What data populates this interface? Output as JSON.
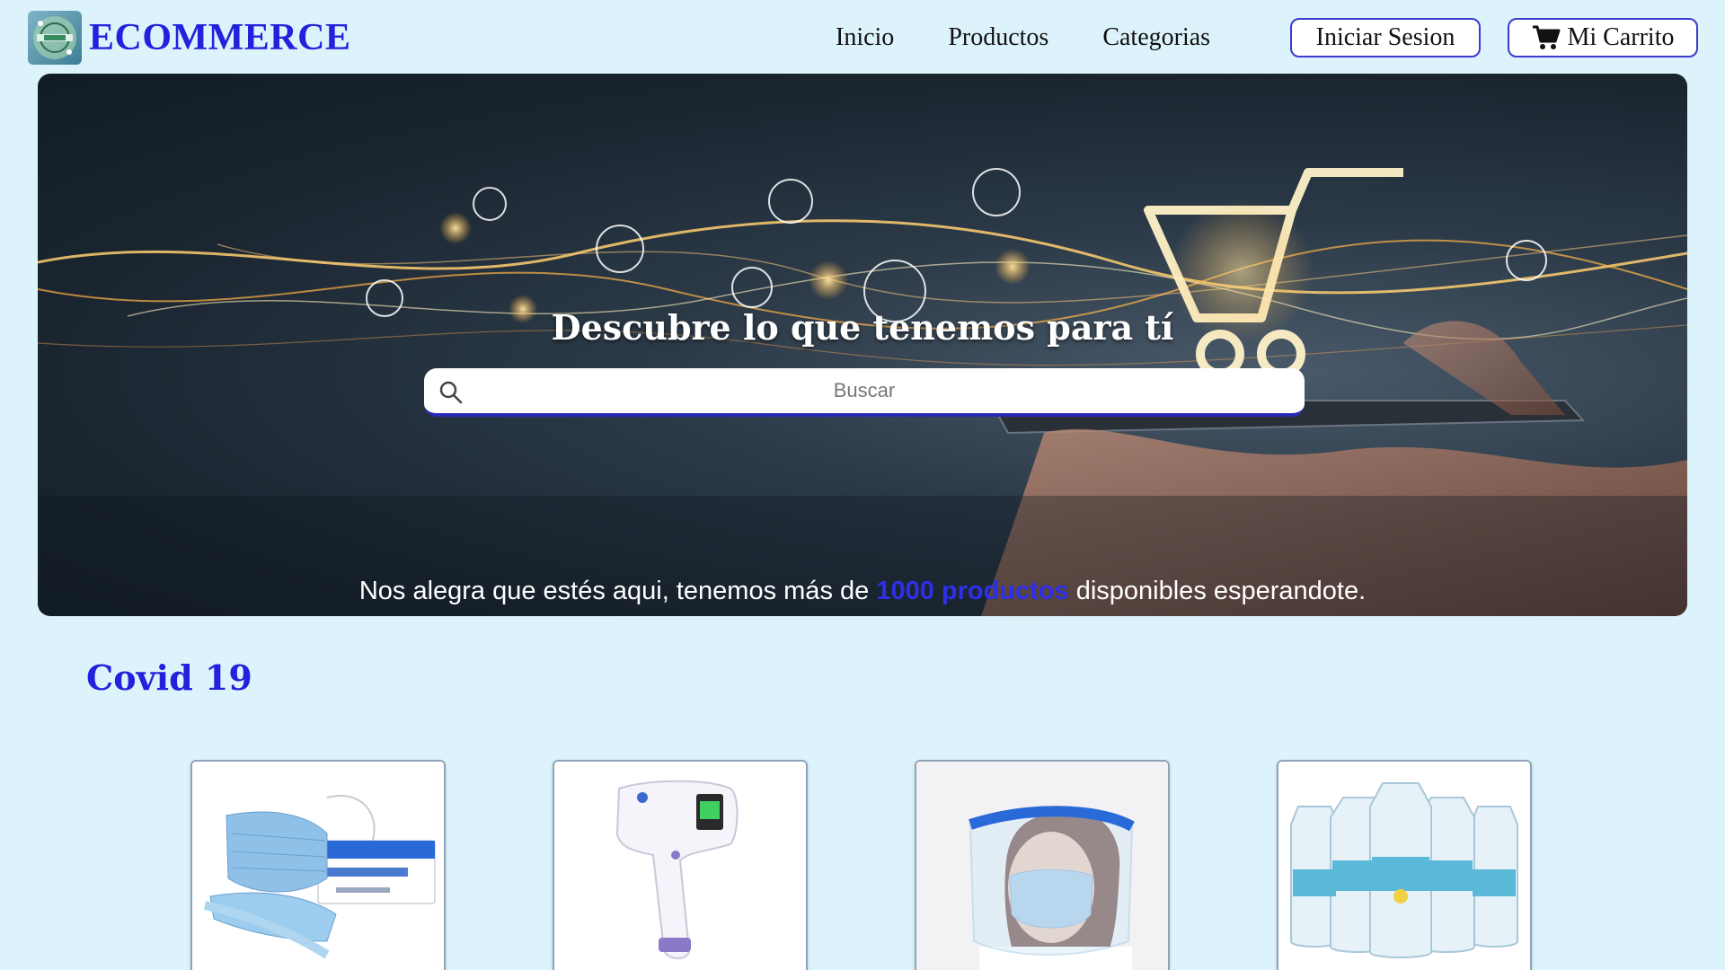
{
  "brand": {
    "name": "ECOMMERCE"
  },
  "nav": {
    "links": [
      "Inicio",
      "Productos",
      "Categorias"
    ],
    "login_label": "Iniciar Sesion",
    "cart_label": "Mi Carrito"
  },
  "hero": {
    "title": "Descubre lo que tenemos para tí",
    "search_placeholder": "Buscar",
    "subtitle_before": "Nos alegra que estés aqui, tenemos más de ",
    "subtitle_highlight": "1000 productos",
    "subtitle_after": " disponibles esperandote."
  },
  "section": {
    "title": "Covid 19"
  },
  "products": [
    {
      "icon": "face-mask-icon"
    },
    {
      "icon": "thermometer-icon"
    },
    {
      "icon": "face-shield-icon"
    },
    {
      "icon": "sanitizer-icon"
    }
  ],
  "colors": {
    "page_bg": "#ddf3fb",
    "brand_blue": "#2222dd",
    "button_border": "#3b3bd0",
    "highlight": "#2f2fe8"
  }
}
